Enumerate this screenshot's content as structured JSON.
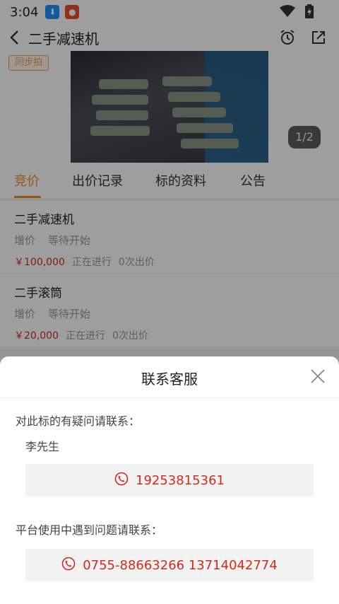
{
  "status": {
    "time": "3:04"
  },
  "header": {
    "title": "二手减速机"
  },
  "hero": {
    "badge": "同步拍",
    "counter": "1/2"
  },
  "tabs": [
    {
      "label": "竞价"
    },
    {
      "label": "出价记录"
    },
    {
      "label": "标的资料"
    },
    {
      "label": "公告"
    }
  ],
  "lots": [
    {
      "name": "二手减速机",
      "increment_label": "增价",
      "start_status": "等待开始",
      "price": "￥100,000",
      "progress": "正在进行",
      "bids": "0次出价"
    },
    {
      "name": "二手滚筒",
      "increment_label": "增价",
      "start_status": "等待开始",
      "price": "￥20,000",
      "progress": "正在进行",
      "bids": "0次出价"
    }
  ],
  "contact_sheet": {
    "title": "联系客服",
    "lot_question_label": "对此标的有疑问请联系：",
    "contact_name": "李先生",
    "contact_phone": "19253815361",
    "platform_question_label": "平台使用中遇到问题请联系：",
    "platform_phones": "0755-88663266 13714042774"
  },
  "colors": {
    "accent": "#ef8c1e",
    "price": "#d52b1e"
  }
}
